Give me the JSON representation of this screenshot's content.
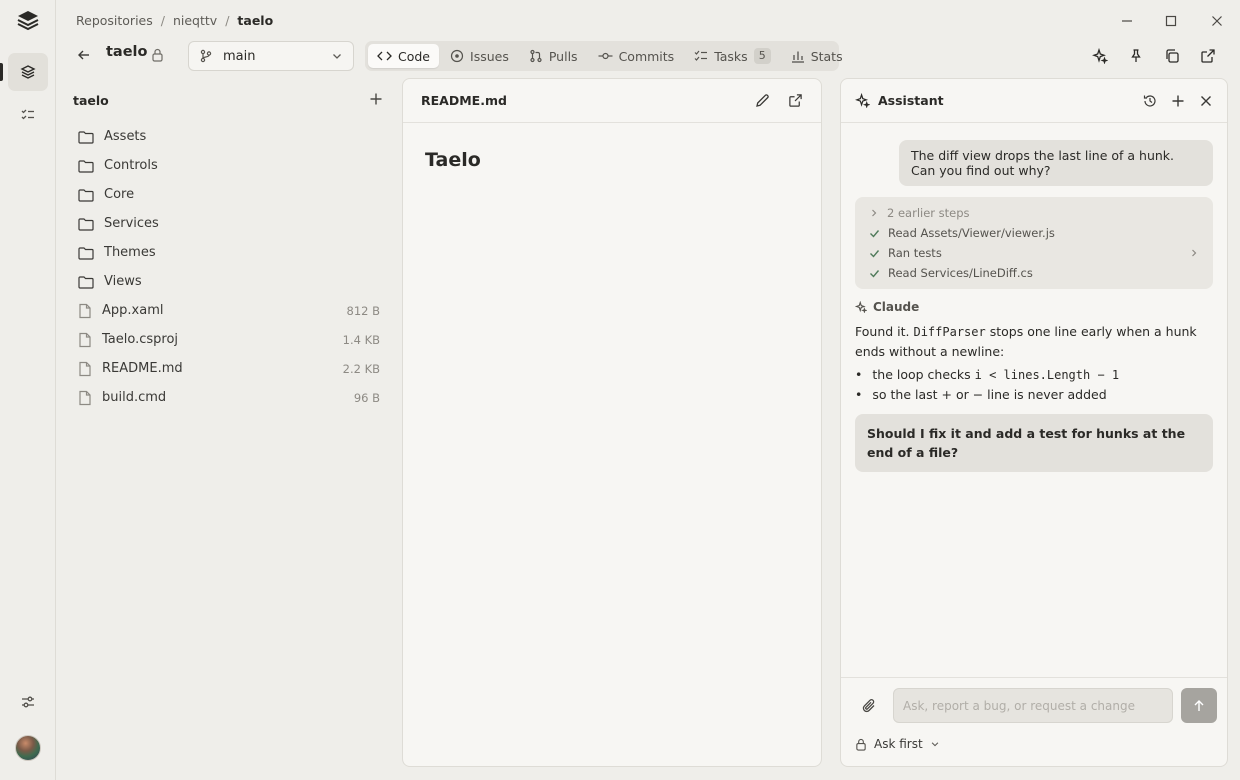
{
  "breadcrumb": {
    "items": [
      "Repositories",
      "nieqttv",
      "taelo"
    ]
  },
  "repo": {
    "name": "taelo"
  },
  "branch": {
    "selected": "main"
  },
  "tabs": [
    {
      "label": "Code",
      "icon": "code-icon",
      "active": true
    },
    {
      "label": "Issues",
      "icon": "issue-icon"
    },
    {
      "label": "Pulls",
      "icon": "pull-request-icon"
    },
    {
      "label": "Commits",
      "icon": "commit-icon"
    },
    {
      "label": "Tasks",
      "icon": "tasks-icon",
      "badge": "5"
    },
    {
      "label": "Stats",
      "icon": "stats-icon"
    }
  ],
  "tree": {
    "title": "taelo",
    "items": [
      {
        "name": "Assets",
        "type": "folder"
      },
      {
        "name": "Controls",
        "type": "folder"
      },
      {
        "name": "Core",
        "type": "folder"
      },
      {
        "name": "Services",
        "type": "folder"
      },
      {
        "name": "Themes",
        "type": "folder"
      },
      {
        "name": "Views",
        "type": "folder"
      },
      {
        "name": "App.xaml",
        "type": "file",
        "size": "812 B"
      },
      {
        "name": "Taelo.csproj",
        "type": "file",
        "size": "1.4 KB"
      },
      {
        "name": "README.md",
        "type": "file",
        "size": "2.2 KB"
      },
      {
        "name": "build.cmd",
        "type": "file",
        "size": "96 B"
      }
    ]
  },
  "editor": {
    "filename": "README.md",
    "heading": "Taelo"
  },
  "assistant": {
    "title": "Assistant",
    "user_message": "The diff view drops the last line of a hunk. Can you find out why?",
    "steps": [
      {
        "label": "2 earlier steps",
        "kind": "collapsed"
      },
      {
        "label": "Read Assets/Viewer/viewer.js",
        "kind": "done"
      },
      {
        "label": "Ran tests",
        "kind": "done",
        "expandable": true
      },
      {
        "label": "Read Services/LineDiff.cs",
        "kind": "done"
      }
    ],
    "reply_author": "Claude",
    "reply": {
      "lead_before": "Found it.",
      "lead_code": "DiffParser",
      "lead_after": "stops one line early when a hunk ends without a newline:",
      "bullet1_text": "the loop checks",
      "bullet1_code": "i < lines.Length − 1",
      "bullet2_text": "so the last + or − line is never added"
    },
    "question": "Should I fix it and add a test for hunks at the end of a file?",
    "composer": {
      "placeholder": "Ask, report a bug, or request a change",
      "value": ""
    },
    "mode": "Ask first"
  }
}
